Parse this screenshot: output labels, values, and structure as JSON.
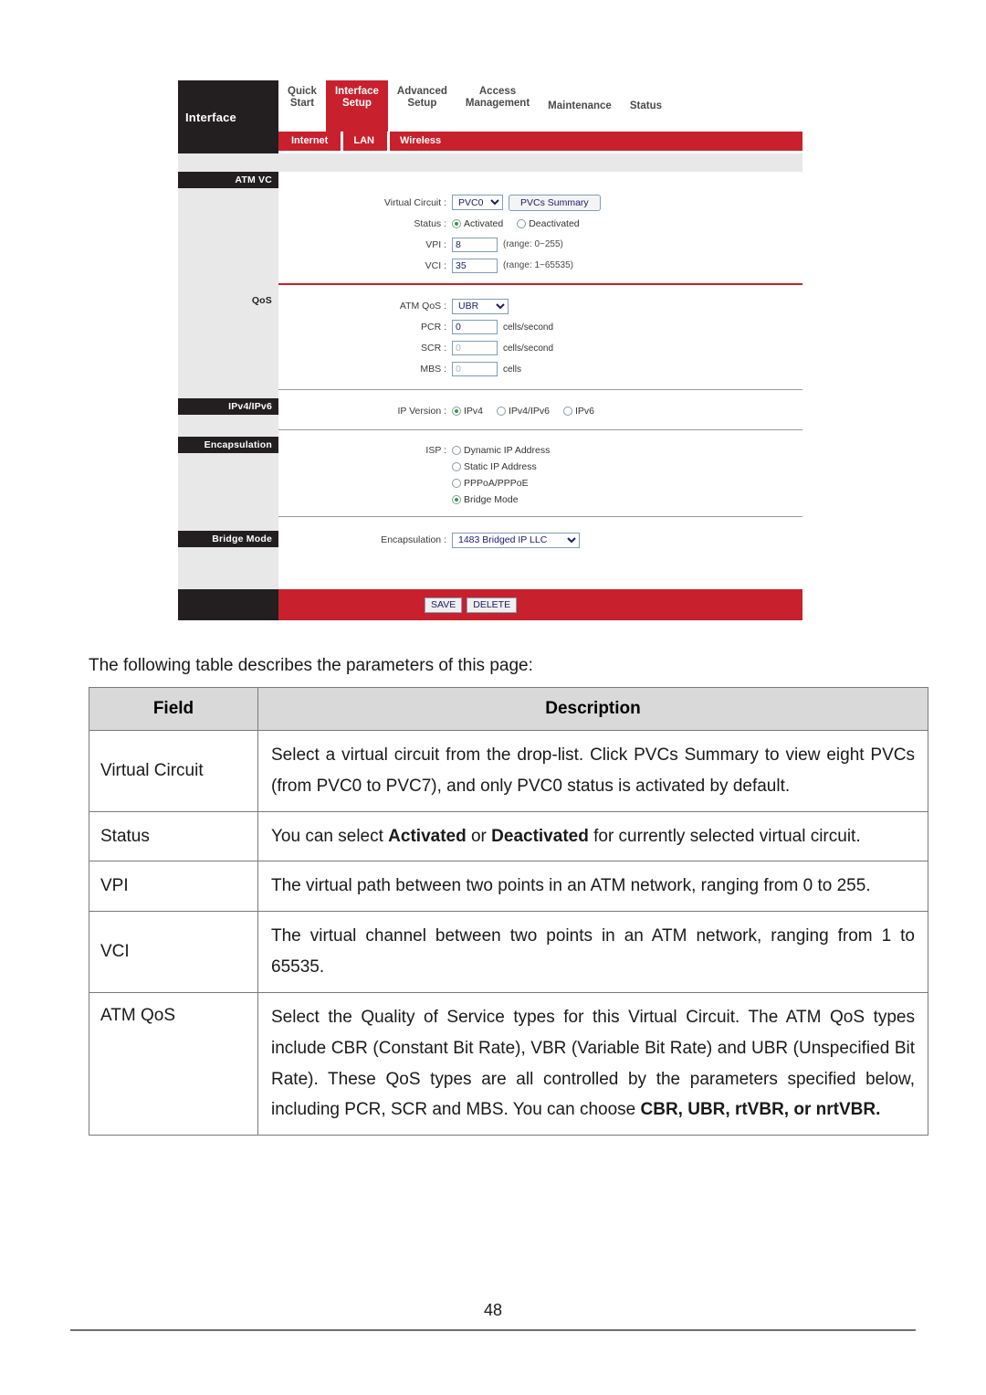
{
  "router_ui": {
    "brand_label": "Interface",
    "top_tabs": [
      {
        "name": "quick-start",
        "line1": "Quick",
        "line2": "Start",
        "active": false
      },
      {
        "name": "interface-setup",
        "line1": "Interface",
        "line2": "Setup",
        "active": true
      },
      {
        "name": "advanced-setup",
        "line1": "Advanced",
        "line2": "Setup",
        "active": false
      },
      {
        "name": "access-management",
        "line1": "Access",
        "line2": "Management",
        "active": false
      },
      {
        "name": "maintenance",
        "line1": "Maintenance",
        "line2": "",
        "active": false
      },
      {
        "name": "status",
        "line1": "Status",
        "line2": "",
        "active": false
      }
    ],
    "sub_tabs": [
      {
        "name": "internet",
        "label": "Internet"
      },
      {
        "name": "lan",
        "label": "LAN"
      },
      {
        "name": "wireless",
        "label": "Wireless"
      }
    ],
    "sections": {
      "atm_vc": "ATM VC",
      "qos": "QoS",
      "ipv4_ipv6": "IPv4/IPv6",
      "encapsulation": "Encapsulation",
      "bridge_mode": "Bridge Mode"
    },
    "fields": {
      "virtual_circuit_label": "Virtual Circuit :",
      "virtual_circuit_value": "PVC0",
      "pvcs_summary_button": "PVCs Summary",
      "status_label": "Status :",
      "status_activated": "Activated",
      "status_deactivated": "Deactivated",
      "vpi_label": "VPI :",
      "vpi_value": "8",
      "vpi_hint": "(range: 0~255)",
      "vci_label": "VCI :",
      "vci_value": "35",
      "vci_hint": "(range: 1~65535)",
      "atm_qos_label": "ATM QoS :",
      "atm_qos_value": "UBR",
      "pcr_label": "PCR :",
      "pcr_value": "0",
      "pcr_unit": "cells/second",
      "scr_label": "SCR :",
      "scr_value": "0",
      "scr_unit": "cells/second",
      "mbs_label": "MBS :",
      "mbs_value": "0",
      "mbs_unit": "cells",
      "ip_version_label": "IP Version :",
      "ip_v4": "IPv4",
      "ip_v4v6": "IPv4/IPv6",
      "ip_v6": "IPv6",
      "isp_label": "ISP :",
      "isp_dynamic": "Dynamic IP Address",
      "isp_static": "Static IP Address",
      "isp_pppoa": "PPPoA/PPPoE",
      "isp_bridge": "Bridge Mode",
      "encapsulation_label": "Encapsulation :",
      "encapsulation_value": "1483 Bridged IP LLC",
      "save_button": "SAVE",
      "delete_button": "DELETE"
    },
    "colors": {
      "accent_red": "#c8202c",
      "dark": "#231f20",
      "panel_gray": "#e8e8e8",
      "radio_on": "#27a335"
    }
  },
  "document": {
    "intro": "The following table describes the parameters of this page:",
    "table": {
      "headers": {
        "field": "Field",
        "description": "Description"
      },
      "rows": [
        {
          "field": "Virtual Circuit",
          "description": "Select a virtual circuit from the drop-list. Click PVCs Summary to view eight PVCs (from PVC0 to PVC7), and only PVC0 status is activated by default."
        },
        {
          "field": "Status",
          "description_prefix": "You can select ",
          "description_bold_1": "Activated",
          "description_mid": " or ",
          "description_bold_2": "Deactivated",
          "description_suffix": " for currently selected virtual circuit."
        },
        {
          "field": "VPI",
          "description": "The virtual path between two points in an ATM network, ranging from 0 to 255."
        },
        {
          "field": "VCI",
          "description": "The virtual channel between two points in an ATM network, ranging from 1 to 65535."
        },
        {
          "field": "ATM QoS",
          "description": "Select the Quality of Service types for this Virtual Circuit. The ATM QoS types include CBR (Constant Bit Rate), VBR (Variable Bit Rate) and UBR (Unspecified Bit Rate). These QoS types are all controlled by the parameters specified below, including PCR, SCR and MBS. You can choose ",
          "description_bold_tail": "CBR, UBR, rtVBR, or nrtVBR."
        }
      ]
    },
    "page_number": "48"
  }
}
